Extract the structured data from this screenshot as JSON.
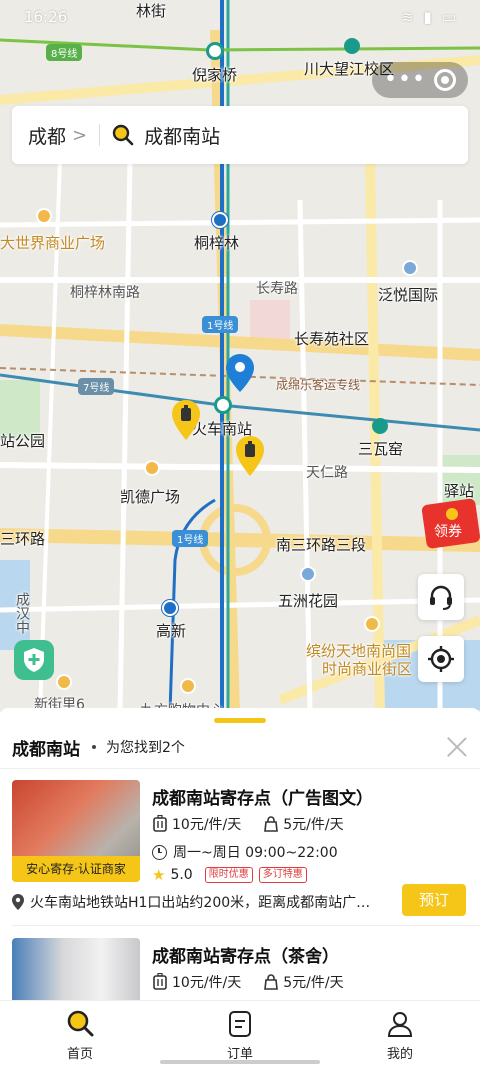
{
  "status_bar": {
    "time": "16:26"
  },
  "search": {
    "city": "成都",
    "query": "成都南站"
  },
  "map": {
    "labels": {
      "linjie": "林街",
      "nijiaqiao": "倪家桥",
      "chuanda": "川大望江校区",
      "shijie": "大世界商业广场",
      "tongzilin": "桐梓林",
      "tongzilin_nan": "桐梓林南路",
      "changshou_lu": "长寿路",
      "fanyue": "泛悦国际",
      "changshouyuan": "长寿苑社区",
      "chengmian": "成绵乐客运专线",
      "huochenanzhan": "火车南站",
      "sanwayao": "三瓦窑",
      "zhangongyuan": "站公园",
      "tianren_lu": "天仁路",
      "kaide": "凯德广场",
      "yiduzhan": "驿站",
      "sanhuan_lu": "三环路",
      "nansanhuan": "南三环路三段",
      "wufen": "五洲花园",
      "gaoxin": "高新",
      "binfen": "缤纷天地南尚国",
      "shishang": "时尚商业街区",
      "chenghan": "成汉中",
      "xinjie": "新街里6",
      "daguo": "九方购物中心",
      "jiefang": "解放"
    },
    "badges": {
      "line8": "8号线",
      "line1a": "1号线",
      "line7": "7号线",
      "line1b": "1号线"
    },
    "coupon": "领券"
  },
  "panel": {
    "title": "成都南站",
    "count_text": "为您找到2个",
    "results": [
      {
        "name": "成都南站寄存点（广告图文）",
        "price_small": "10元/件/天",
        "price_bag": "5元/件/天",
        "hours": "周一~周日 09:00~22:00",
        "rating": "5.0",
        "promo1": "限时优惠",
        "promo2": "多订特惠",
        "badge": "安心寄存·认证商家",
        "address": "火车南站地铁站H1口出站约200米，距离成都南站广…",
        "book": "预订"
      },
      {
        "name": "成都南站寄存点（茶舍）",
        "price_small": "10元/件/天",
        "price_bag": "5元/件/天"
      }
    ]
  },
  "tabs": [
    {
      "label": "首页",
      "icon": "search-icon"
    },
    {
      "label": "订单",
      "icon": "order-icon"
    },
    {
      "label": "我的",
      "icon": "user-icon"
    }
  ],
  "colors": {
    "accent": "#f5c518",
    "metro_line1": "#3b8fd6",
    "station_green": "#1a9a8a"
  }
}
